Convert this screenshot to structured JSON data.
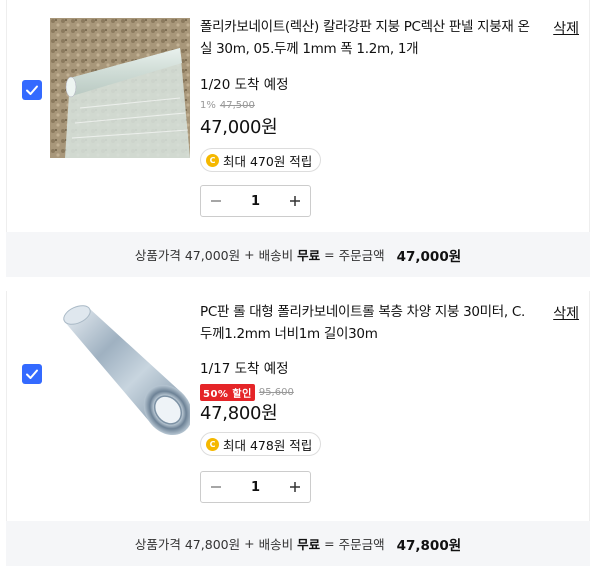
{
  "items": [
    {
      "title": "폴리카보네이트(렉산) 칼라강판 지붕 PC렉산 판넬 지붕재 온실 30m, 05.두께 1mm 폭 1.2m, 1개",
      "delete_label": "삭제",
      "delivery": "1/20 도착 예정",
      "discount_rate": "1%",
      "original_price": "47,500",
      "price": "47,000원",
      "reward": "최대 470원 적립",
      "quantity": "1",
      "summary": {
        "product_price_label": "상품가격",
        "product_price": "47,000원",
        "plus": "+",
        "shipping_label": "배송비",
        "shipping_value": "무료",
        "equals": "=",
        "order_total_label": "주문금액",
        "order_total": "47,000원"
      }
    },
    {
      "title": "PC판 롤 대형 폴리카보네이트롤 복층 차양 지붕 30미터, C. 두께1.2mm 너비1m 길이30m",
      "delete_label": "삭제",
      "delivery": "1/17 도착 예정",
      "sale_badge": "50% 할인",
      "original_price": "95,600",
      "price": "47,800원",
      "reward": "최대 478원 적립",
      "quantity": "1",
      "summary": {
        "product_price_label": "상품가격",
        "product_price": "47,800원",
        "plus": "+",
        "shipping_label": "배송비",
        "shipping_value": "무료",
        "equals": "=",
        "order_total_label": "주문금액",
        "order_total": "47,800원"
      }
    }
  ],
  "icons": {
    "checkbox": "check-icon",
    "minus": "minus-icon",
    "plus": "plus-icon",
    "coin": "coin-icon"
  },
  "colors": {
    "accent": "#346aff",
    "sale": "#e52528",
    "coin": "#f5b800",
    "summary_bg": "#f5f6f8"
  }
}
